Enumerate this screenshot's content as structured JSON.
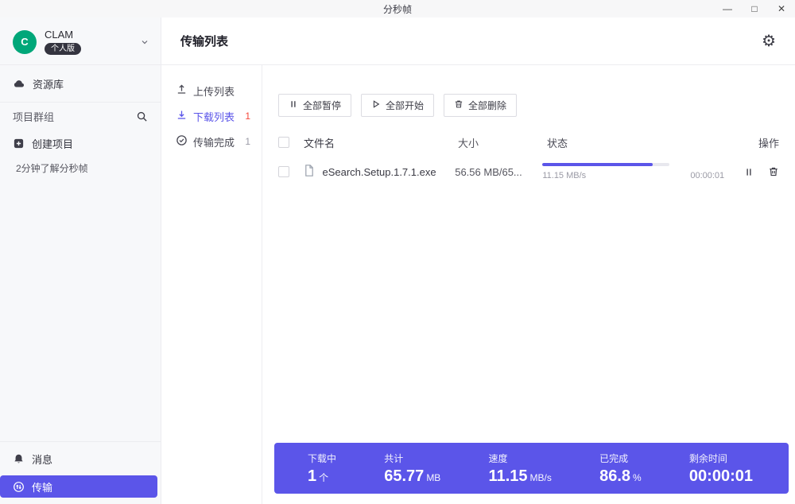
{
  "colors": {
    "accent": "#5B55E9",
    "avatar": "#00A779",
    "danger": "#F5483B"
  },
  "window": {
    "title": "分秒帧",
    "controls": {
      "minimize": "—",
      "maximize": "□",
      "close": "✕"
    }
  },
  "sidebar": {
    "user": {
      "initial": "C",
      "name": "CLAM",
      "badge": "个人版"
    },
    "library": "资源库",
    "projects_label": "项目群组",
    "create_project": "创建项目",
    "tip": "2分钟了解分秒帧",
    "messages": "消息",
    "transfer": "传输"
  },
  "header": {
    "title": "传输列表"
  },
  "tabs": [
    {
      "label": "上传列表",
      "count": ""
    },
    {
      "label": "下载列表",
      "count": "1"
    },
    {
      "label": "传输完成",
      "count": "1"
    }
  ],
  "toolbar": {
    "pause_all": "全部暂停",
    "start_all": "全部开始",
    "delete_all": "全部删除"
  },
  "table": {
    "headers": {
      "name": "文件名",
      "size": "大小",
      "status": "状态",
      "action": "操作"
    },
    "rows": [
      {
        "filename": "eSearch.Setup.1.7.1.exe",
        "size": "56.56 MB/65...",
        "speed": "11.15 MB/s",
        "remaining": "00:00:01",
        "progress": 86.8
      }
    ]
  },
  "stats": [
    {
      "label": "下载中",
      "value": "1",
      "unit": "个"
    },
    {
      "label": "共计",
      "value": "65.77",
      "unit": "MB"
    },
    {
      "label": "速度",
      "value": "11.15",
      "unit": "MB/s"
    },
    {
      "label": "已完成",
      "value": "86.8",
      "unit": "%"
    },
    {
      "label": "剩余时间",
      "value": "00:00:01",
      "unit": ""
    }
  ]
}
